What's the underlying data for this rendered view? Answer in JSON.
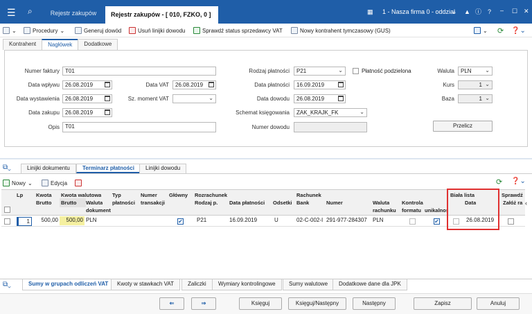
{
  "topbar": {
    "tab1": "Rejestr zakupów",
    "tab2": "Rejestr zakupów - [ 010, FZKO, 0 ] -",
    "company": "1 - Nasza firma 0 - oddział"
  },
  "toolbar": {
    "procedury": "Procedury",
    "generuj": "Generuj dowód",
    "usun": "Usuń linijki dowodu",
    "sprawdz": "Sprawdź status sprzedawcy VAT",
    "nowy": "Nowy kontrahent tymczasowy (GUS)"
  },
  "tabs": [
    "Kontrahent",
    "Nagłówek",
    "Dodatkowe"
  ],
  "form": {
    "numer_faktury_label": "Numer faktury",
    "numer_faktury": "T01",
    "data_wplywu_label": "Data wpływu",
    "data_wplywu": "26.08.2019",
    "data_vat_label": "Data VAT",
    "data_vat": "26.08.2019",
    "data_wystawienia_label": "Data wystawienia",
    "data_wystawienia": "26.08.2019",
    "sz_moment_label": "Sz. moment VAT",
    "sz_moment": "",
    "data_zakupu_label": "Data zakupu",
    "data_zakupu": "26.08.2019",
    "opis_label": "Opis",
    "opis": "T01",
    "rodzaj_label": "Rodzaj płatności",
    "rodzaj": "P21",
    "podzielona_label": "Płatność podzielona",
    "data_platnosci_label": "Data płatności",
    "data_platnosci": "16.09.2019",
    "data_dowodu_label": "Data dowodu",
    "data_dowodu": "26.08.2019",
    "schemat_label": "Schemat księgowania",
    "schemat": "ZAK_KRAJK_FK",
    "numer_dowodu_label": "Numer dowodu",
    "numer_dowodu": "",
    "waluta_label": "Waluta",
    "waluta": "PLN",
    "kurs_label": "Kurs",
    "kurs": "1",
    "baza_label": "Baza",
    "baza": "1",
    "przelicz": "Przelicz"
  },
  "tabs2": [
    "Linijki dokumentu",
    "Terminarz płatności",
    "Linijki dowodu"
  ],
  "grid_toolbar": {
    "nowy": "Nowy",
    "edycja": "Edycja"
  },
  "grid_headers": {
    "lp": "Lp",
    "kwota": "Kwota",
    "brutto": "Brutto",
    "kwota_walutowa": "Kwota walutowa",
    "brutto2": "Brutto",
    "waluta_dok": "Waluta",
    "dokument": "dokument",
    "typ": "Typ",
    "platnosci": "płatności",
    "numer_trans": "Numer",
    "transakcji": "transakcji",
    "glowny": "Główny",
    "rozrachunek": "Rozrachunek",
    "rodzaj_p": "Rodzaj p.",
    "data_platnosci": "Data płatności",
    "odsetki": "Odsetki",
    "rachunek": "Rachunek",
    "bank": "Bank",
    "numer": "Numer",
    "waluta": "Waluta",
    "rachunku": "rachunku",
    "kontrola": "Kontrola",
    "formatu": "formatu",
    "unikalnosc": "unikalność",
    "biala_lista": "Biała lista",
    "data": "Data",
    "sprawdz": "Sprawdź",
    "zaloz": "Załóż ra"
  },
  "grid_row": {
    "lp": "1",
    "brutto": "500,00",
    "brutto_wal": "500,00",
    "waluta": "PLN",
    "rodzaj": "P21",
    "data_platnosci": "16.09.2019",
    "odsetki": "U",
    "bank": "02-C-002-I",
    "numer": "291-977-284307",
    "waluta_rach": "PLN",
    "biala_data": "26.08.2019"
  },
  "bottom_tabs": [
    "Sumy w grupach odliczeń VAT",
    "Kwoty w stawkach VAT",
    "Zaliczki",
    "Wymiary kontrolingowe",
    "Sumy walutowe",
    "Dodatkowe dane dla JPK"
  ],
  "footer": {
    "ksieguj": "Księguj",
    "ksieguj_nastepny": "Księguj/Następny",
    "nastepny": "Następny",
    "zapisz": "Zapisz",
    "anuluj": "Anuluj"
  },
  "colors": {
    "topbar": "#1f5ea8",
    "accent": "#1f5ea8",
    "highlight": "#e3e2e2",
    "money_bg": "#f5f0a0",
    "red_box": "#e03030"
  }
}
